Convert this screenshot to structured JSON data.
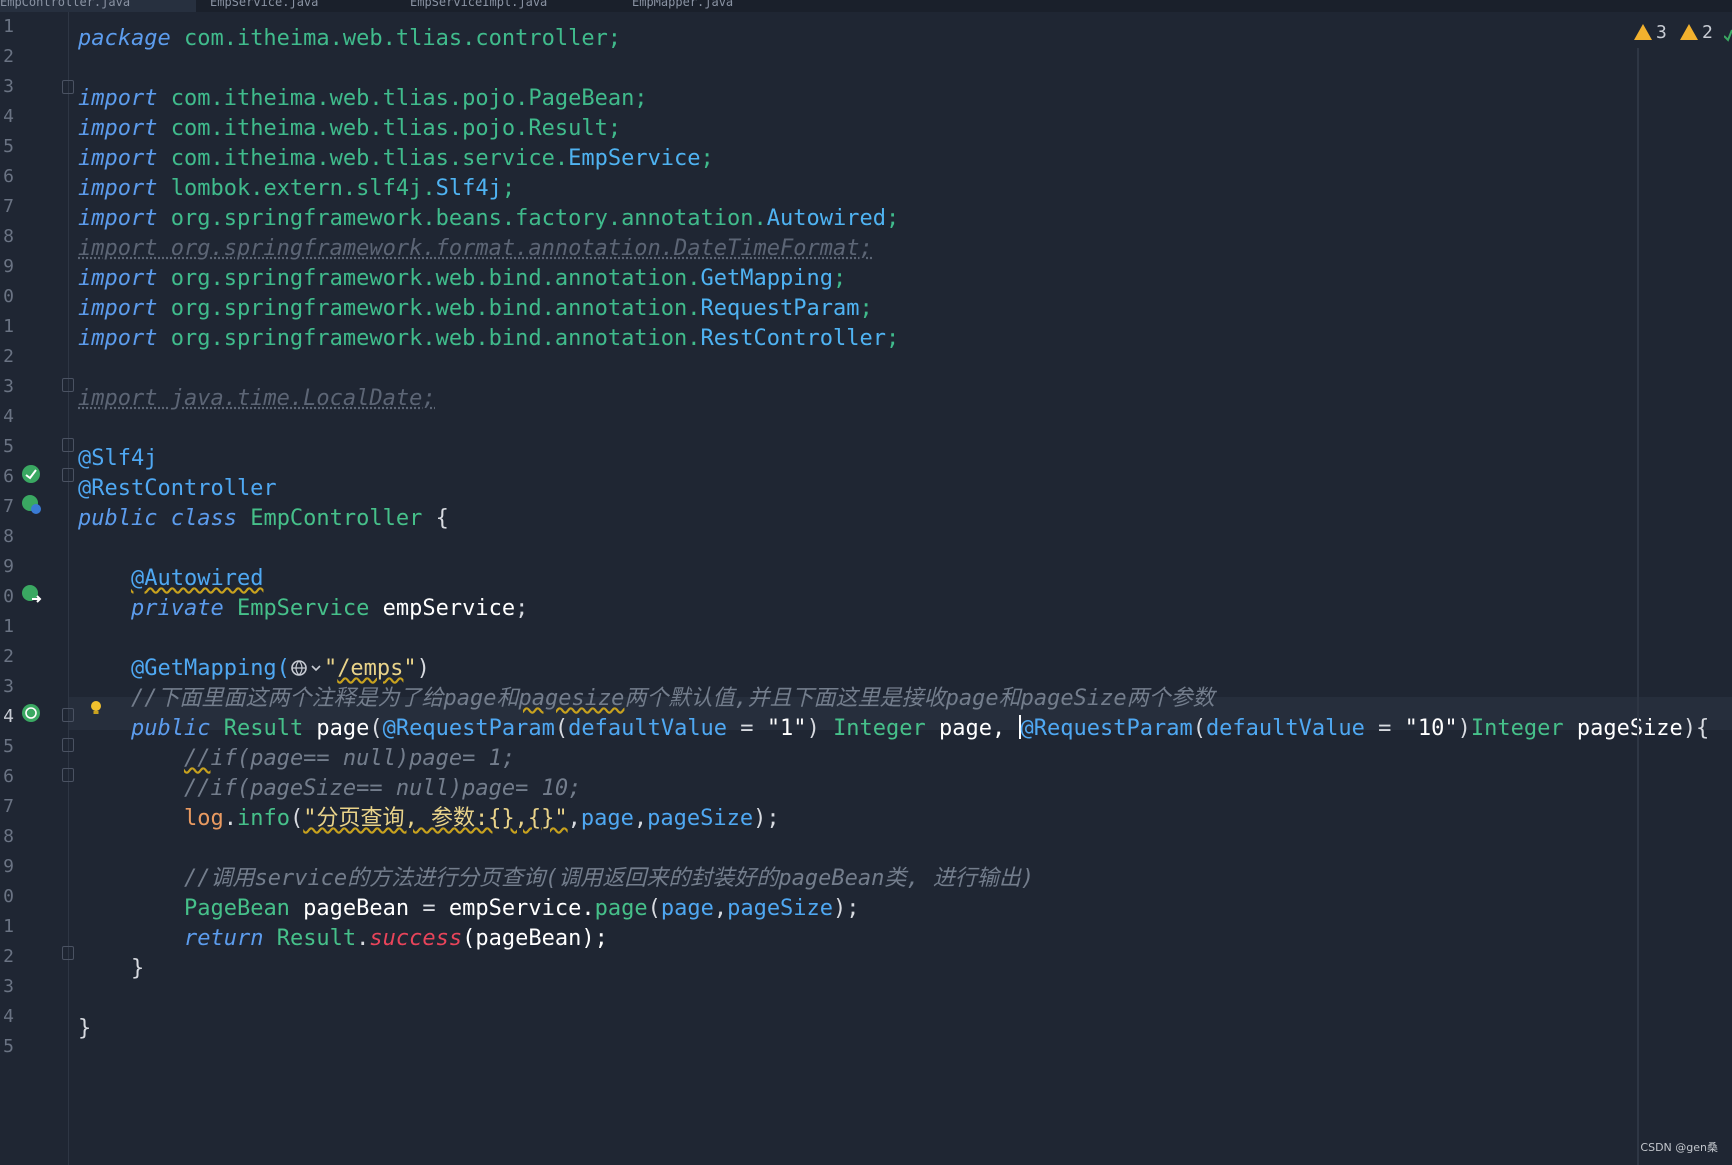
{
  "tabs": [
    {
      "label": "EmpController.java",
      "active": true
    },
    {
      "label": "EmpService.java",
      "active": false
    },
    {
      "label": "EmpServiceImpl.java",
      "active": false
    },
    {
      "label": "EmpMapper.java",
      "active": false
    }
  ],
  "inspections": {
    "warnings_count": "3",
    "weak_warnings_count": "2"
  },
  "line_numbers": [
    "1",
    "2",
    "3",
    "4",
    "5",
    "6",
    "7",
    "8",
    "9",
    "0",
    "1",
    "2",
    "3",
    "4",
    "5",
    "6",
    "7",
    "8",
    "9",
    "0",
    "1",
    "2",
    "3",
    "4",
    "5",
    "6",
    "7",
    "8",
    "9",
    "0",
    "1",
    "2",
    "3",
    "4",
    "5"
  ],
  "code": {
    "l1_kw": "package",
    "l1_rest": " com.itheima.web.tlias.controller;",
    "l3_kw": "import",
    "l3_pkg": " com.itheima.web.tlias.pojo.PageBean;",
    "l4_kw": "import",
    "l4_pkg": " com.itheima.web.tlias.pojo.Result;",
    "l5_kw": "import",
    "l5_pkg": " com.itheima.web.tlias.service.",
    "l5_cls": "EmpService",
    "l5_end": ";",
    "l6_kw": "import",
    "l6_pkg": " lombok.extern.slf4j.",
    "l6_cls": "Slf4j",
    "l6_end": ";",
    "l7_kw": "import",
    "l7_pkg": " org.springframework.beans.factory.annotation.",
    "l7_cls": "Autowired",
    "l7_end": ";",
    "l8_unused": "import org.springframework.format.annotation.DateTimeFormat;",
    "l9_kw": "import",
    "l9_pkg": " org.springframework.web.bind.annotation.",
    "l9_cls": "GetMapping",
    "l9_end": ";",
    "l10_kw": "import",
    "l10_pkg": " org.springframework.web.bind.annotation.",
    "l10_cls": "RequestParam",
    "l10_end": ";",
    "l11_kw": "import",
    "l11_pkg": " org.springframework.web.bind.annotation.",
    "l11_cls": "RestController",
    "l11_end": ";",
    "l13_unused": "import java.time.LocalDate;",
    "l15_an": "@Slf4j",
    "l16_an": "@RestController",
    "l17_kw": "public class",
    "l17_cls": " EmpController",
    "l17_end": " {",
    "l19_an": "@Autowired",
    "l20_kw": "private",
    "l20_ty": " EmpService",
    "l20_name": " empService",
    "l20_end": ";",
    "l22_an": "@GetMapping(",
    "l22_q1": "\"",
    "l22_path": "/emps",
    "l22_q2": "\"",
    "l22_end": ")",
    "l23_cm_a": "//下面里面这两个注释是为了给page和",
    "l23_cm_b": "pagesize",
    "l23_cm_c": "两个默认值,并且下面这里是接收page和pageSize两个参数",
    "l24_kw": "public",
    "l24_ty": " Result",
    "l24_fn": " page",
    "l24_p1": "(",
    "l24_an1": "@RequestParam",
    "l24_p2": "(",
    "l24_dv1": "defaultValue",
    "l24_eq1": " = ",
    "l24_s1": "\"1\"",
    "l24_p3": ") ",
    "l24_int1": "Integer",
    "l24_v1": " page, ",
    "l24_an2": "@RequestParam",
    "l24_p4": "(",
    "l24_dv2": "defaultValue",
    "l24_eq2": " = ",
    "l24_s2": "\"10\"",
    "l24_p5": ")",
    "l24_int2": "Integer",
    "l24_v2": " pageSize",
    "l24_end": "){",
    "l25_cm_a": "//",
    "l25_cm_b": "if(page== null)page= 1;",
    "l26_cm": "//if(pageSize== null)page= 10;",
    "l27_log": "log",
    "l27_dot": ".",
    "l27_info": "info",
    "l27_p1": "(",
    "l27_str": "\"分页查询, 参数:{},{}\"",
    "l27_c1": ",",
    "l27_a1": "page",
    "l27_c2": ",",
    "l27_a2": "pageSize",
    "l27_end": ");",
    "l29_cm": "//调用service的方法进行分页查询(调用返回来的封装好的pageBean类, 进行输出)",
    "l30_ty": "PageBean",
    "l30_var": " pageBean",
    "l30_eq": " = ",
    "l30_obj": "empService.",
    "l30_fn": "page",
    "l30_p1": "(",
    "l30_a1": "page",
    "l30_c": ",",
    "l30_a2": "pageSize",
    "l30_end": ");",
    "l31_kw": "return",
    "l31_ty": " Result",
    "l31_dot": ".",
    "l31_fn": "success",
    "l31_arg": "(pageBean);",
    "l32_brace": "}",
    "l34_brace": "}"
  },
  "watermark": "CSDN @gen桑",
  "colors": {
    "background": "#1f2633",
    "keyword": "#5c9ced",
    "package": "#40bb8c",
    "annotation": "#4fa8f2",
    "string": "#e9d38a",
    "comment": "#737d8c",
    "warning": "#f2b12e"
  }
}
